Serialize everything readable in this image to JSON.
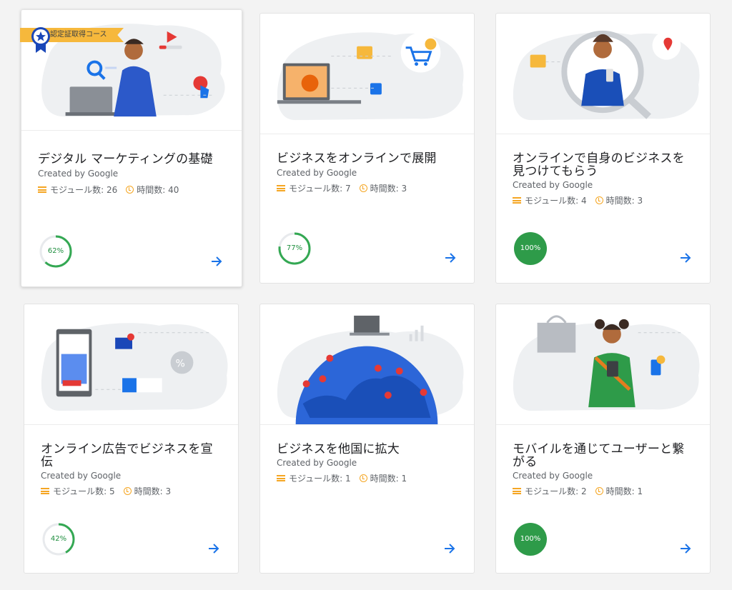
{
  "badge": {
    "label": "認定証取得コース"
  },
  "colors": {
    "progress_green": "#34a853",
    "complete_green": "#2e9b49",
    "arrow_blue": "#1a73e8",
    "accent_orange": "#f5a623"
  },
  "icons": {
    "modules": "modules-icon",
    "hours": "clock-icon",
    "open": "arrow-right-icon"
  },
  "courses": [
    {
      "title": "デジタル マーケティングの基礎",
      "creator": "Created by Google",
      "modules": "モジュール数: 26",
      "hours": "時間数: 40",
      "progress": 0.62,
      "progress_label": "62%"
    },
    {
      "title": "ビジネスをオンラインで展開",
      "creator": "Created by Google",
      "modules": "モジュール数: 7",
      "hours": "時間数: 3",
      "progress": 0.77,
      "progress_label": "77%"
    },
    {
      "title": "オンラインで自身のビジネスを見つけてもらう",
      "creator": "Created by Google",
      "modules": "モジュール数: 4",
      "hours": "時間数: 3",
      "progress": 1.0,
      "progress_label": "100%"
    },
    {
      "title": "オンライン広告でビジネスを宣伝",
      "creator": "Created by Google",
      "modules": "モジュール数: 5",
      "hours": "時間数: 3",
      "progress": 0.42,
      "progress_label": "42%"
    },
    {
      "title": "ビジネスを他国に拡大",
      "creator": "Created by Google",
      "modules": "モジュール数: 1",
      "hours": "時間数: 1"
    },
    {
      "title": "モバイルを通じてユーザーと繋がる",
      "creator": "Created by Google",
      "modules": "モジュール数: 2",
      "hours": "時間数: 1",
      "progress": 1.0,
      "progress_label": "100%"
    }
  ]
}
